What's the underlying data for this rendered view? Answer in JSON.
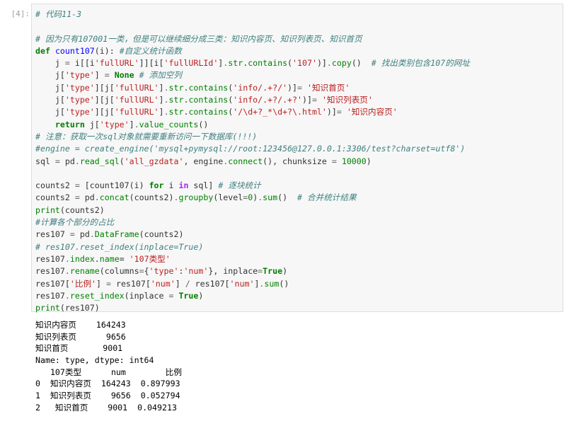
{
  "cell": {
    "prompt": "[4]:",
    "code_lines": [
      [
        {
          "t": "# 代码11-3",
          "c": "cm"
        }
      ],
      [],
      [
        {
          "t": "# 因为只有107001一类，但是可以继续细分成三类：知识内容页、知识列表页、知识首页",
          "c": "cm"
        }
      ],
      [
        {
          "t": "def",
          "c": "k"
        },
        {
          "t": " "
        },
        {
          "t": "count107",
          "c": "f"
        },
        {
          "t": "(i): "
        },
        {
          "t": "#自定义统计函数",
          "c": "cm"
        }
      ],
      [
        {
          "t": "    j "
        },
        {
          "t": "=",
          "c": "op"
        },
        {
          "t": " i[[i"
        },
        {
          "t": "'fullURL'",
          "c": "s"
        },
        {
          "t": "]][i["
        },
        {
          "t": "'fullURLId'",
          "c": "s"
        },
        {
          "t": "]"
        },
        {
          "t": ".",
          "c": "op"
        },
        {
          "t": "str",
          "c": "n"
        },
        {
          "t": "."
        },
        {
          "t": "contains",
          "c": "n"
        },
        {
          "t": "("
        },
        {
          "t": "'107'",
          "c": "s"
        },
        {
          "t": ")]"
        },
        {
          "t": ".",
          "c": "op"
        },
        {
          "t": "copy",
          "c": "n"
        },
        {
          "t": "()  "
        },
        {
          "t": "# 找出类别包含107的网址",
          "c": "cm"
        }
      ],
      [
        {
          "t": "    j["
        },
        {
          "t": "'type'",
          "c": "s"
        },
        {
          "t": "] "
        },
        {
          "t": "=",
          "c": "op"
        },
        {
          "t": " "
        },
        {
          "t": "None",
          "c": "cn"
        },
        {
          "t": " "
        },
        {
          "t": "# 添加空列",
          "c": "cm"
        }
      ],
      [
        {
          "t": "    j["
        },
        {
          "t": "'type'",
          "c": "s"
        },
        {
          "t": "][j["
        },
        {
          "t": "'fullURL'",
          "c": "s"
        },
        {
          "t": "]"
        },
        {
          "t": ".",
          "c": "op"
        },
        {
          "t": "str",
          "c": "n"
        },
        {
          "t": "."
        },
        {
          "t": "contains",
          "c": "n"
        },
        {
          "t": "("
        },
        {
          "t": "'info/.+?/'",
          "c": "s"
        },
        {
          "t": ")]"
        },
        {
          "t": "=",
          "c": "op"
        },
        {
          "t": " "
        },
        {
          "t": "'知识首页'",
          "c": "s"
        }
      ],
      [
        {
          "t": "    j["
        },
        {
          "t": "'type'",
          "c": "s"
        },
        {
          "t": "][j["
        },
        {
          "t": "'fullURL'",
          "c": "s"
        },
        {
          "t": "]"
        },
        {
          "t": ".",
          "c": "op"
        },
        {
          "t": "str",
          "c": "n"
        },
        {
          "t": "."
        },
        {
          "t": "contains",
          "c": "n"
        },
        {
          "t": "("
        },
        {
          "t": "'info/.+?/.+?'",
          "c": "s"
        },
        {
          "t": ")]"
        },
        {
          "t": "=",
          "c": "op"
        },
        {
          "t": " "
        },
        {
          "t": "'知识列表页'",
          "c": "s"
        }
      ],
      [
        {
          "t": "    j["
        },
        {
          "t": "'type'",
          "c": "s"
        },
        {
          "t": "][j["
        },
        {
          "t": "'fullURL'",
          "c": "s"
        },
        {
          "t": "]"
        },
        {
          "t": ".",
          "c": "op"
        },
        {
          "t": "str",
          "c": "n"
        },
        {
          "t": "."
        },
        {
          "t": "contains",
          "c": "n"
        },
        {
          "t": "("
        },
        {
          "t": "'/\\d+?_*\\d+?\\.html'",
          "c": "s"
        },
        {
          "t": ")]"
        },
        {
          "t": "=",
          "c": "op"
        },
        {
          "t": " "
        },
        {
          "t": "'知识内容页'",
          "c": "s"
        }
      ],
      [
        {
          "t": "    "
        },
        {
          "t": "return",
          "c": "k"
        },
        {
          "t": " j["
        },
        {
          "t": "'type'",
          "c": "s"
        },
        {
          "t": "]"
        },
        {
          "t": ".",
          "c": "op"
        },
        {
          "t": "value_counts",
          "c": "n"
        },
        {
          "t": "()"
        }
      ],
      [
        {
          "t": "# 注意：获取一次sql对象就需要重新访问一下数据库(!!!)",
          "c": "cm"
        }
      ],
      [
        {
          "t": "#engine = create_engine('mysql+pymysql://root:123456@127.0.0.1:3306/test?charset=utf8')",
          "c": "cm"
        }
      ],
      [
        {
          "t": "sql "
        },
        {
          "t": "=",
          "c": "op"
        },
        {
          "t": " pd"
        },
        {
          "t": ".",
          "c": "op"
        },
        {
          "t": "read_sql",
          "c": "n"
        },
        {
          "t": "("
        },
        {
          "t": "'all_gzdata'",
          "c": "s"
        },
        {
          "t": ", engine"
        },
        {
          "t": ".",
          "c": "op"
        },
        {
          "t": "connect",
          "c": "n"
        },
        {
          "t": "(), chunksize "
        },
        {
          "t": "=",
          "c": "op"
        },
        {
          "t": " "
        },
        {
          "t": "10000",
          "c": "nu"
        },
        {
          "t": ")"
        }
      ],
      [],
      [
        {
          "t": "counts2 "
        },
        {
          "t": "=",
          "c": "op"
        },
        {
          "t": " [count107(i) "
        },
        {
          "t": "for",
          "c": "k"
        },
        {
          "t": " i "
        },
        {
          "t": "in",
          "c": "o"
        },
        {
          "t": " sql] "
        },
        {
          "t": "# 逐块统计",
          "c": "cm"
        }
      ],
      [
        {
          "t": "counts2 "
        },
        {
          "t": "=",
          "c": "op"
        },
        {
          "t": " pd"
        },
        {
          "t": ".",
          "c": "op"
        },
        {
          "t": "concat",
          "c": "n"
        },
        {
          "t": "(counts2)"
        },
        {
          "t": ".",
          "c": "op"
        },
        {
          "t": "groupby",
          "c": "n"
        },
        {
          "t": "(level"
        },
        {
          "t": "=",
          "c": "op"
        },
        {
          "t": "0",
          "c": "nu"
        },
        {
          "t": ")"
        },
        {
          "t": ".",
          "c": "op"
        },
        {
          "t": "sum",
          "c": "n"
        },
        {
          "t": "()  "
        },
        {
          "t": "# 合并统计结果",
          "c": "cm"
        }
      ],
      [
        {
          "t": "print",
          "c": "n"
        },
        {
          "t": "(counts2)"
        }
      ],
      [
        {
          "t": "#计算各个部分的占比",
          "c": "cm"
        }
      ],
      [
        {
          "t": "res107 "
        },
        {
          "t": "=",
          "c": "op"
        },
        {
          "t": " pd"
        },
        {
          "t": ".",
          "c": "op"
        },
        {
          "t": "DataFrame",
          "c": "n"
        },
        {
          "t": "(counts2)"
        }
      ],
      [
        {
          "t": "# res107.reset_index(inplace=True)",
          "c": "cm"
        }
      ],
      [
        {
          "t": "res107"
        },
        {
          "t": ".",
          "c": "op"
        },
        {
          "t": "index",
          "c": "n"
        },
        {
          "t": "."
        },
        {
          "t": "name",
          "c": "n"
        },
        {
          "t": "= "
        },
        {
          "t": "'107类型'",
          "c": "s"
        }
      ],
      [
        {
          "t": "res107"
        },
        {
          "t": ".",
          "c": "op"
        },
        {
          "t": "rename",
          "c": "n"
        },
        {
          "t": "(columns"
        },
        {
          "t": "=",
          "c": "op"
        },
        {
          "t": "{"
        },
        {
          "t": "'type'",
          "c": "s"
        },
        {
          "t": ":"
        },
        {
          "t": "'num'",
          "c": "s"
        },
        {
          "t": "}, inplace"
        },
        {
          "t": "=",
          "c": "op"
        },
        {
          "t": "True",
          "c": "cn"
        },
        {
          "t": ")"
        }
      ],
      [
        {
          "t": "res107["
        },
        {
          "t": "'比例'",
          "c": "s"
        },
        {
          "t": "] "
        },
        {
          "t": "=",
          "c": "op"
        },
        {
          "t": " res107["
        },
        {
          "t": "'num'",
          "c": "s"
        },
        {
          "t": "] "
        },
        {
          "t": "/",
          "c": "op"
        },
        {
          "t": " res107["
        },
        {
          "t": "'num'",
          "c": "s"
        },
        {
          "t": "]"
        },
        {
          "t": ".",
          "c": "op"
        },
        {
          "t": "sum",
          "c": "n"
        },
        {
          "t": "()"
        }
      ],
      [
        {
          "t": "res107"
        },
        {
          "t": ".",
          "c": "op"
        },
        {
          "t": "reset_index",
          "c": "n"
        },
        {
          "t": "(inplace "
        },
        {
          "t": "=",
          "c": "op"
        },
        {
          "t": " "
        },
        {
          "t": "True",
          "c": "cn"
        },
        {
          "t": ")"
        }
      ],
      [
        {
          "t": "print",
          "c": "n"
        },
        {
          "t": "(res107)"
        }
      ]
    ]
  },
  "output": {
    "lines": [
      "知识内容页    164243",
      "知识列表页      9656",
      "知识首页       9001",
      "Name: type, dtype: int64",
      "   107类型      num        比例",
      "0  知识内容页  164243  0.897993",
      "1  知识列表页    9656  0.052794",
      "2   知识首页    9001  0.049213"
    ]
  }
}
